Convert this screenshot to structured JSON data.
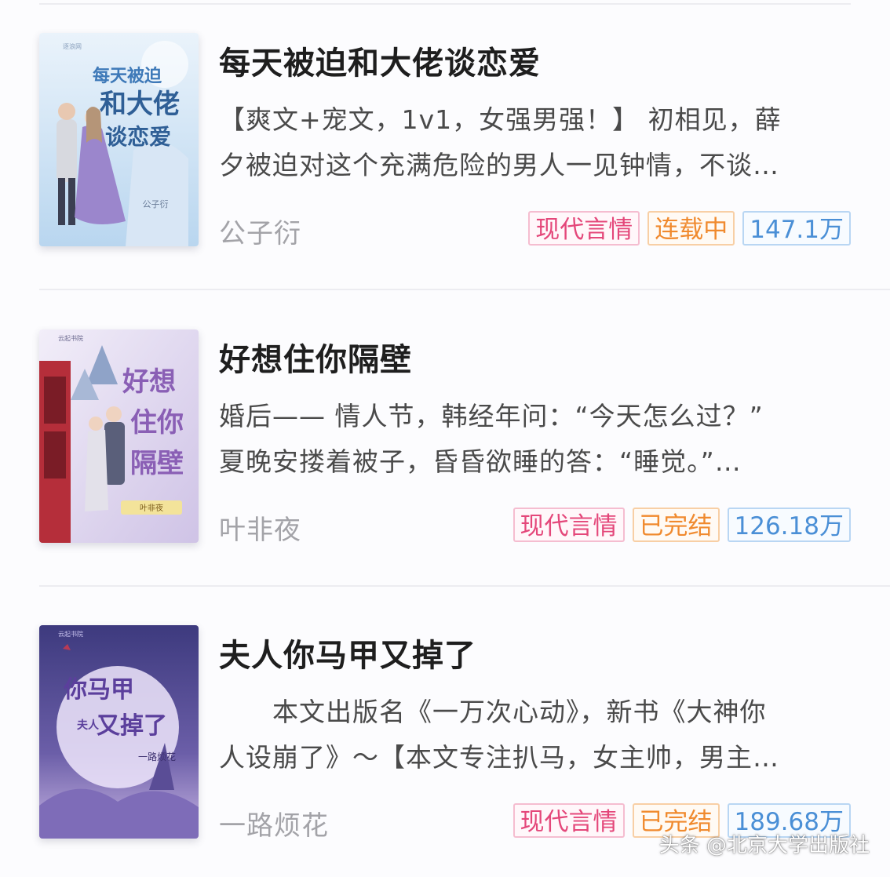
{
  "books": [
    {
      "title": "每天被迫和大佬谈恋爱",
      "desc_lines": [
        "【爽文+宠文，1v1，女强男强！】 初相见，薛",
        "夕被迫对这个充满危险的男人一见钟情，不谈…"
      ],
      "author": "公子衍",
      "tags": {
        "genre": "现代言情",
        "status": "连载中",
        "count": "147.1万"
      },
      "cover": {
        "title_lines": [
          "每天被迫",
          "和大佬",
          "谈恋爱"
        ],
        "author": "公子衍",
        "publisher": "逐浪网",
        "bg": "#cfe3f4",
        "accent": "#3e79b8"
      }
    },
    {
      "title": "好想住你隔壁",
      "desc_lines": [
        "婚后—— 情人节，韩经年问：“今天怎么过？”",
        "夏晚安搂着被子，昏昏欲睡的答：“睡觉。”…"
      ],
      "author": "叶非夜",
      "tags": {
        "genre": "现代言情",
        "status": "已完结",
        "count": "126.18万"
      },
      "cover": {
        "title_lines": [
          "好想",
          "住你",
          "隔壁"
        ],
        "author": "叶非夜",
        "publisher": "云起书院",
        "bg": "#e6e1f2",
        "accent": "#8a5fb5"
      }
    },
    {
      "title": "夫人你马甲又掉了",
      "desc_lines": [
        "　　本文出版名《一万次心动》，新书《大神你",
        "人设崩了》～【本文专注扒马，女主帅，男主…"
      ],
      "author": "一路烦花",
      "tags": {
        "genre": "现代言情",
        "status": "已完结",
        "count": "189.68万"
      },
      "cover": {
        "title_lines": [
          "你马甲",
          "又掉了",
          "夫人"
        ],
        "author": "一路烦花",
        "publisher": "云起书院",
        "bg": "#4c4a8f",
        "accent": "#f2ecff"
      }
    }
  ],
  "watermark": "头条 @北京大学出版社"
}
